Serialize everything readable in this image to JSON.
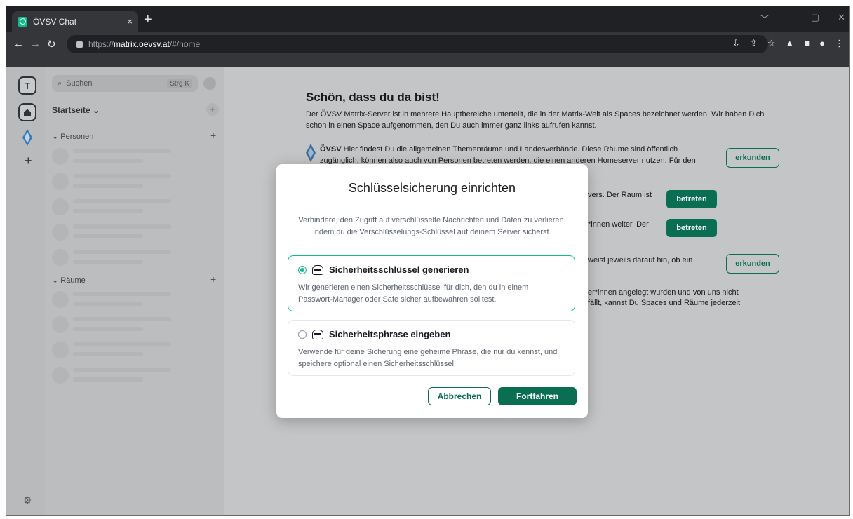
{
  "browser": {
    "tab_title": "ÖVSV Chat",
    "tab_close": "×",
    "new_tab": "+",
    "url_scheme": "https://",
    "url_host": "matrix.oevsv.at",
    "url_path": "/#/home",
    "window_controls": [
      "﹀",
      "–",
      "▢",
      "✕"
    ],
    "toolbar_icons": [
      "⇩",
      "⇪",
      "☆",
      "▲",
      "■",
      "●",
      "⋮"
    ]
  },
  "spaces": {
    "user_initial": "T",
    "add": "+",
    "settings": "⚙"
  },
  "roomlist": {
    "search_placeholder": "Suchen",
    "search_shortcut": "Strg K",
    "home_label": "Startseite ⌄",
    "home_plus": "+",
    "people_label": "⌄ Personen",
    "people_plus": "+",
    "rooms_label": "⌄ Räume",
    "rooms_plus": "+"
  },
  "main": {
    "welcome_title": "Schön, dass du da bist!",
    "intro": "Der ÖVSV Matrix-Server ist in mehrere Hauptbereiche unterteilt, die in der Matrix-Welt als Spaces bezeichnet werden. Wir haben Dich schon in einen Space aufgenommen, den Du auch immer ganz links aufrufen kannst.",
    "ovsv_name": "ÖVSV",
    "ovsv_text_1": " Hier findest Du die allgemeinen Themenräume und Landesverbände. Diese Räume sind öffentlich",
    "ovsv_text_2": "zugänglich, können also auch von Personen betreten werden, die einen anderen Homeserver nutzen. Für den",
    "line_raum": "vers. Der Raum ist",
    "line_innen": "*innen weiter. Der",
    "line_hin": "weist jeweils darauf hin, ob ein",
    "line_ernicht": "er*innen angelegt wurden und von uns nicht",
    "line_faellt": "fällt, kannst Du Spaces und Räume jederzeit",
    "explore_1": "erkunden",
    "join_1": "betreten",
    "join_2": "betreten",
    "explore_2": "erkunden"
  },
  "dialog": {
    "title": "Schlüsselsicherung einrichten",
    "description": "Verhindere, den Zugriff auf verschlüsselte Nachrichten und Daten zu verlieren, indem du die Verschlüsselungs-Schlüssel auf deinem Server sicherst.",
    "option_key_title": "Sicherheitsschlüssel generieren",
    "option_key_desc": "Wir generieren einen Sicherheitsschlüssel für dich, den du in einem Passwort-Manager oder Safe sicher aufbewahren solltest.",
    "option_phrase_title": "Sicherheitsphrase eingeben",
    "option_phrase_desc": "Verwende für deine Sicherung eine geheime Phrase, die nur du kennst, und speichere optional einen Sicherheitsschlüssel.",
    "cancel_label": "Abbrechen",
    "continue_label": "Fortfahren"
  },
  "colors": {
    "accent": "#0dbd8b",
    "button_primary": "#0a6e52"
  }
}
